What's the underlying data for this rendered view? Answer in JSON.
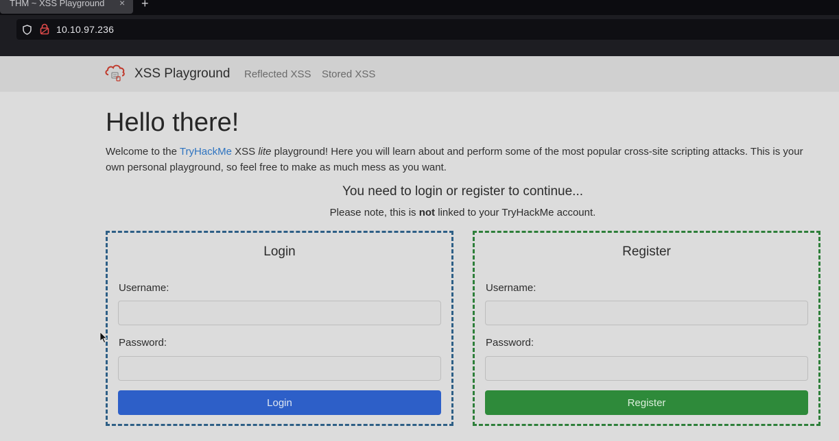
{
  "browser": {
    "tab_title": "THM ~ XSS Playground",
    "tab_close": "×",
    "new_tab": "+",
    "url": "10.10.97.236"
  },
  "nav": {
    "brand": "XSS Playground",
    "links": [
      "Reflected XSS",
      "Stored XSS"
    ]
  },
  "main": {
    "heading": "Hello there!",
    "intro_prefix": "Welcome to the ",
    "intro_link": "TryHackMe",
    "intro_mid": " XSS ",
    "intro_em": "lite",
    "intro_suffix": " playground! Here you will learn about and perform some of the most popular cross-site scripting attacks. This is your own personal playground, so feel free to make as much mess as you want.",
    "cta": "You need to login or register to continue...",
    "note_prefix": "Please note, this is ",
    "note_bold": "not",
    "note_suffix": " linked to your TryHackMe account."
  },
  "login": {
    "title": "Login",
    "username_label": "Username:",
    "username_value": "",
    "password_label": "Password:",
    "password_value": "",
    "button": "Login"
  },
  "register": {
    "title": "Register",
    "username_label": "Username:",
    "username_value": "",
    "password_label": "Password:",
    "password_value": "",
    "button": "Register"
  },
  "colors": {
    "login_border": "#2e5f86",
    "register_border": "#2e7f3a",
    "login_button": "#2d5fc8",
    "register_button": "#2e8a3a",
    "link": "#2f74c0"
  },
  "icons": [
    "shield-icon",
    "lock-icon",
    "cloud-logo-icon",
    "mouse-cursor-icon"
  ]
}
